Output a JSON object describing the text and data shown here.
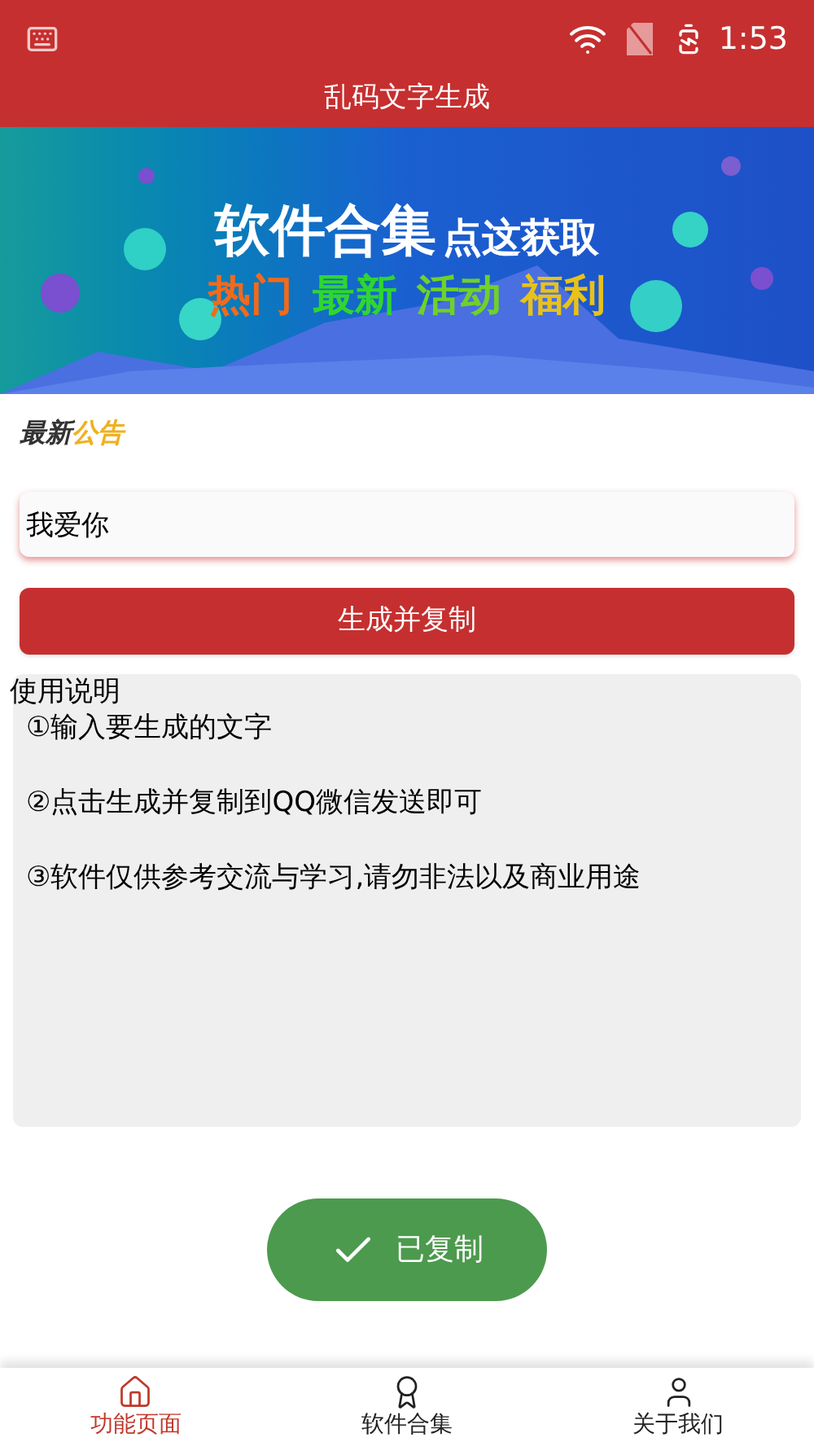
{
  "status_bar": {
    "time": "1:53"
  },
  "app_bar": {
    "title": "乱码文字生成"
  },
  "banner": {
    "title": "软件合集",
    "subtitle": "点这获取",
    "tags": [
      {
        "text": "热门",
        "color": "#f26a1b"
      },
      {
        "text": "最新",
        "color": "#2fd62f"
      },
      {
        "text": "活动",
        "color": "#6fd12a"
      },
      {
        "text": "福利",
        "color": "#e8c21a"
      }
    ]
  },
  "notice": {
    "label_dark": "最新",
    "label_accent": "公告"
  },
  "input": {
    "value": "我爱你"
  },
  "generate_button": {
    "label": "生成并复制"
  },
  "instructions": {
    "title": "使用说明",
    "lines": [
      "①输入要生成的文字",
      "②点击生成并复制到QQ微信发送即可",
      "③软件仅供参考交流与学习,请勿非法以及商业用途"
    ]
  },
  "toast": {
    "text": "已复制"
  },
  "bottom_nav": [
    {
      "label": "功能页面",
      "selected": true
    },
    {
      "label": "软件合集",
      "selected": false
    },
    {
      "label": "关于我们",
      "selected": false
    }
  ]
}
